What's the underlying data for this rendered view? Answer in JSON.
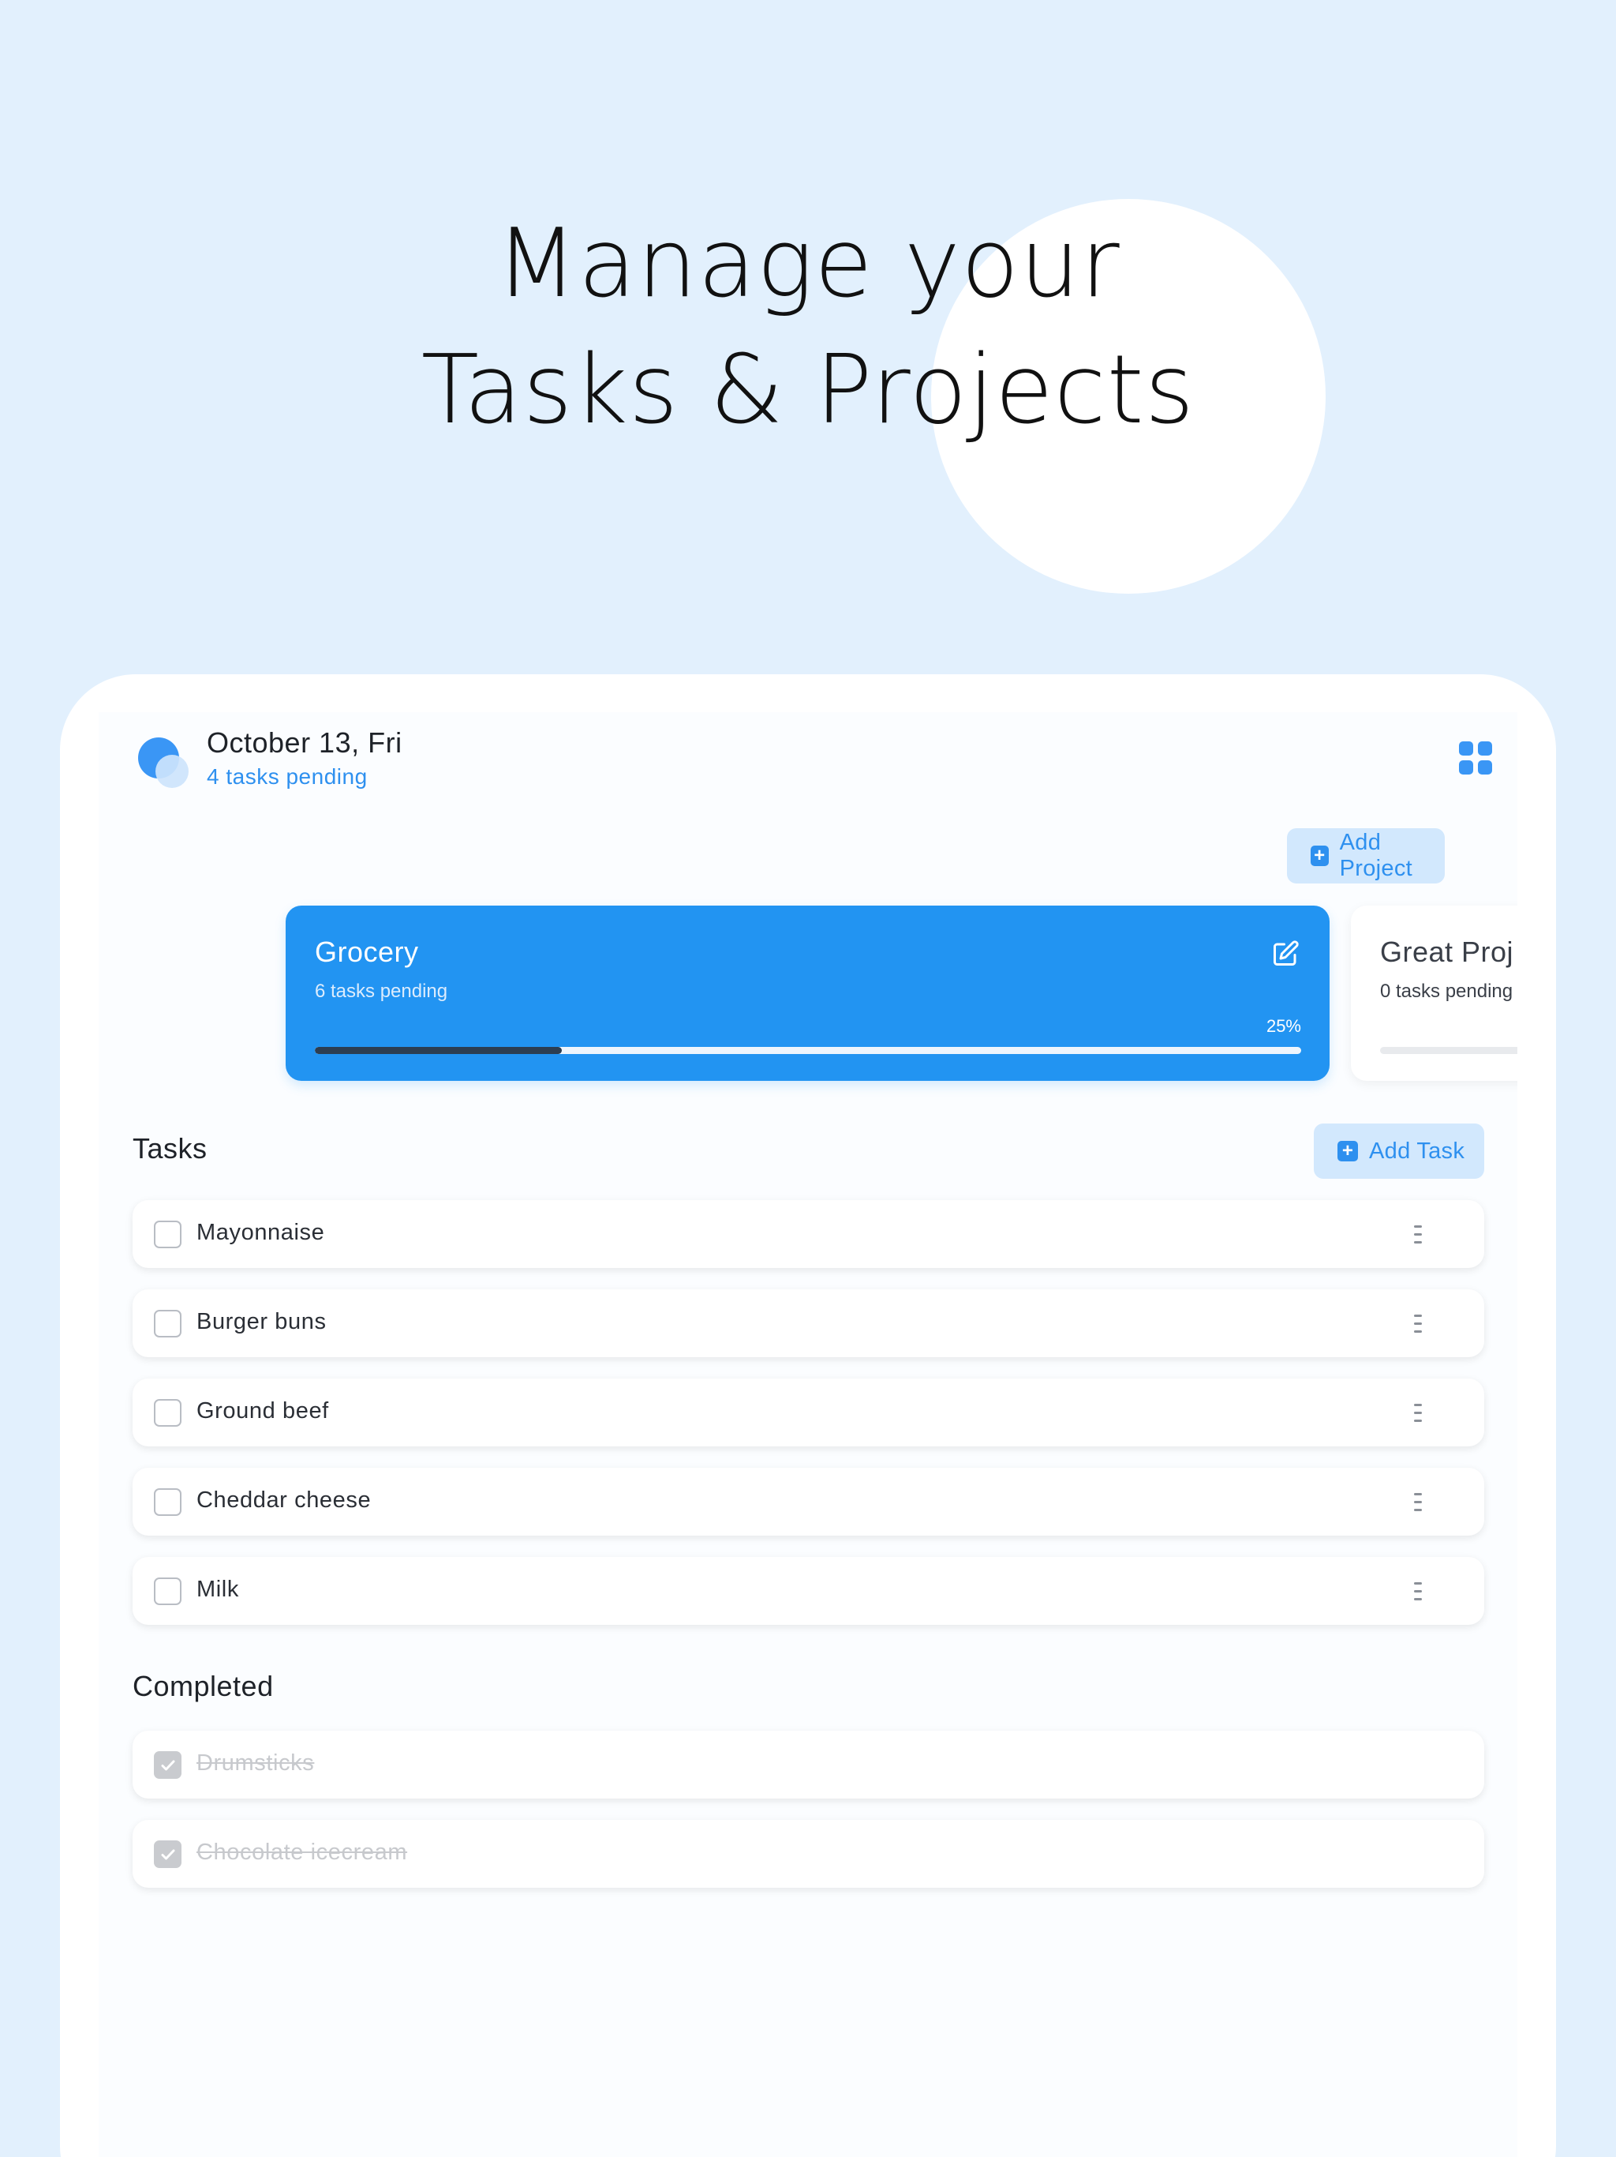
{
  "headline": {
    "line1": "Manage your",
    "line2": "Tasks & Projects"
  },
  "header": {
    "date": "October 13, Fri",
    "pending": "4 tasks pending",
    "grid_icon": "grid-icon"
  },
  "buttons": {
    "add_project": "Add Project",
    "add_task": "Add Task"
  },
  "projects": [
    {
      "name": "Grocery",
      "pending": "6 tasks pending",
      "progress_label": "25%",
      "progress": 0.25
    },
    {
      "name": "Great Proj",
      "pending": "0 tasks pending",
      "progress": 0
    }
  ],
  "sections": {
    "tasks": "Tasks",
    "completed": "Completed"
  },
  "tasks": [
    {
      "label": "Mayonnaise",
      "done": false
    },
    {
      "label": "Burger buns",
      "done": false
    },
    {
      "label": "Ground beef",
      "done": false
    },
    {
      "label": "Cheddar cheese",
      "done": false
    },
    {
      "label": "Milk",
      "done": false
    }
  ],
  "completed": [
    {
      "label": "Drumsticks",
      "done": true
    },
    {
      "label": "Chocolate icecream",
      "done": true
    }
  ],
  "colors": {
    "background": "#e2f0fd",
    "accent": "#2294f2",
    "soft_button": "#d2e8fd",
    "progress_fill": "#2c3e52"
  }
}
